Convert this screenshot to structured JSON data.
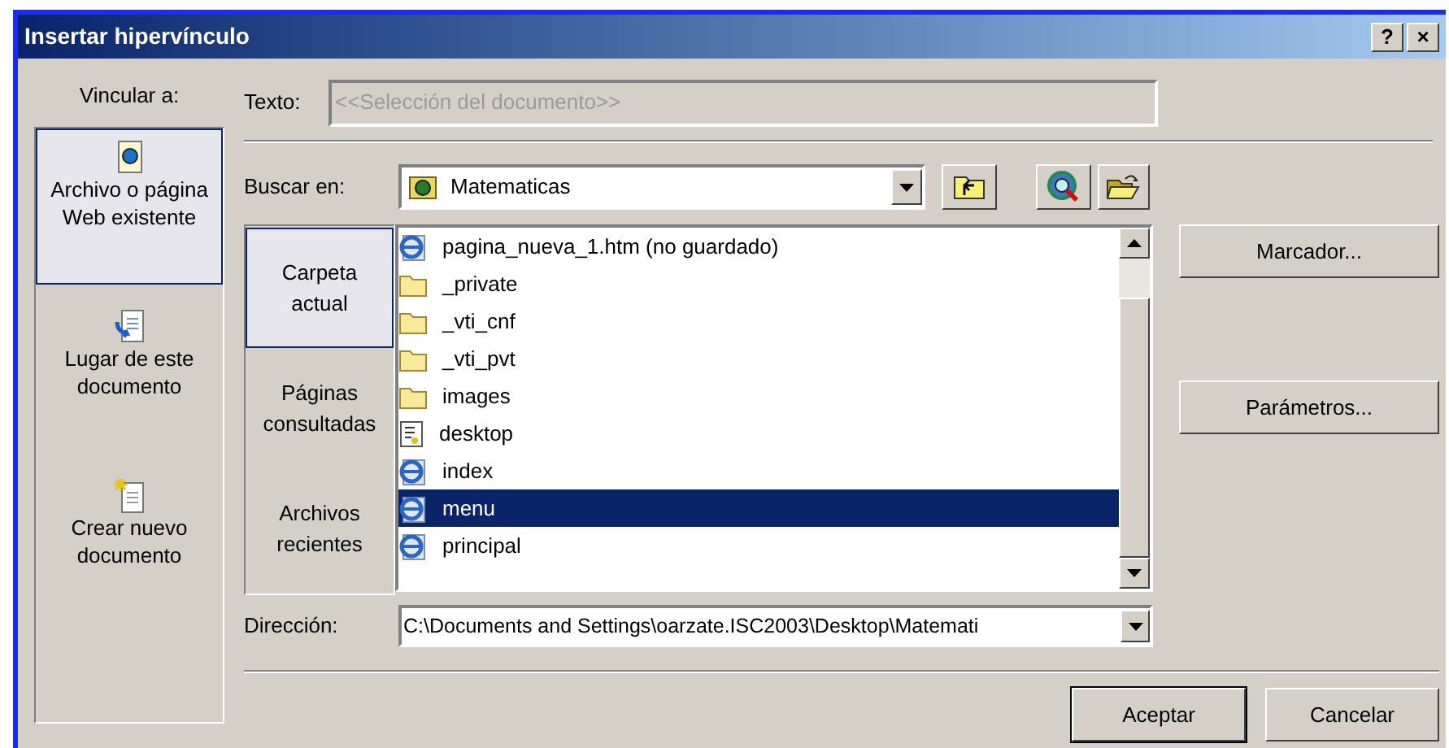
{
  "window": {
    "title": "Insertar hipervínculo",
    "title_buttons": [
      "?",
      "×"
    ]
  },
  "link_to": {
    "label": "Vincular a:",
    "items": [
      {
        "label": "Archivo o página Web existente",
        "kind": "file",
        "selected": true
      },
      {
        "label": "Lugar de este documento",
        "kind": "place",
        "selected": false
      },
      {
        "label": "Crear nuevo documento",
        "kind": "new",
        "selected": false
      }
    ]
  },
  "text_field": {
    "label": "Texto:",
    "value": "<<Selección del documento>>",
    "disabled": true
  },
  "look_in": {
    "label": "Buscar en:",
    "value": "Matematicas"
  },
  "places": [
    {
      "label": "Carpeta actual",
      "selected": true
    },
    {
      "label": "Páginas consultadas",
      "selected": false
    },
    {
      "label": "Archivos recientes",
      "selected": false
    }
  ],
  "files": [
    {
      "name": "pagina_nueva_1.htm (no guardado)",
      "kind": "web",
      "selected": false
    },
    {
      "name": "_private",
      "kind": "folder",
      "selected": false
    },
    {
      "name": "_vti_cnf",
      "kind": "folder",
      "selected": false
    },
    {
      "name": "_vti_pvt",
      "kind": "folder",
      "selected": false
    },
    {
      "name": "images",
      "kind": "folder",
      "selected": false
    },
    {
      "name": "desktop",
      "kind": "settings",
      "selected": false
    },
    {
      "name": "index",
      "kind": "web",
      "selected": false
    },
    {
      "name": "menu",
      "kind": "web",
      "selected": true
    },
    {
      "name": "principal",
      "kind": "web",
      "selected": false
    }
  ],
  "side_buttons": [
    "Marcador...",
    "Parámetros..."
  ],
  "address": {
    "label": "Dirección:",
    "value": "C:\\Documents and Settings\\oarzate.ISC2003\\Desktop\\Matemati"
  },
  "buttons": [
    "Aceptar",
    "Cancelar"
  ]
}
